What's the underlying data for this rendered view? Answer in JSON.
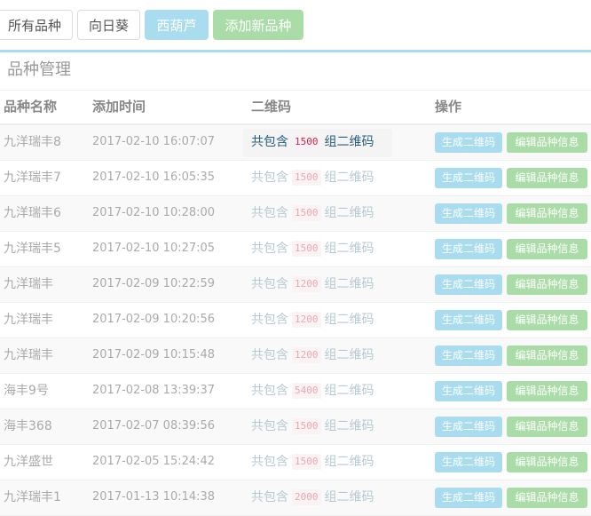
{
  "tabs": [
    {
      "label": "所有品种"
    },
    {
      "label": "向日葵"
    },
    {
      "label": "西葫芦"
    },
    {
      "label": "添加新品种"
    }
  ],
  "panel": {
    "title": "品种管理"
  },
  "table": {
    "headers": [
      "品种名称",
      "添加时间",
      "二维码",
      "操作"
    ],
    "qr_prefix": "共包含",
    "qr_suffix": "组二维码",
    "action_generate": "生成二维码",
    "action_edit": "编辑品种信息",
    "rows": [
      {
        "name": "九洋瑞丰8",
        "time": "2017-02-10 16:07:07",
        "count": "1500"
      },
      {
        "name": "九洋瑞丰7",
        "time": "2017-02-10 16:05:35",
        "count": "1500"
      },
      {
        "name": "九洋瑞丰6",
        "time": "2017-02-10 10:28:00",
        "count": "1500"
      },
      {
        "name": "九洋瑞丰5",
        "time": "2017-02-10 10:27:05",
        "count": "1500"
      },
      {
        "name": "九洋瑞丰",
        "time": "2017-02-09 10:22:59",
        "count": "1200"
      },
      {
        "name": "九洋瑞丰",
        "time": "2017-02-09 10:20:56",
        "count": "1200"
      },
      {
        "name": "九洋瑞丰",
        "time": "2017-02-09 10:15:48",
        "count": "1200"
      },
      {
        "name": "海丰9号",
        "time": "2017-02-08 13:39:37",
        "count": "5400"
      },
      {
        "name": "海丰368",
        "time": "2017-02-07 08:39:56",
        "count": "1500"
      },
      {
        "name": "九洋盛世",
        "time": "2017-02-05 15:24:42",
        "count": "1500"
      },
      {
        "name": "九洋瑞丰1",
        "time": "2017-01-13 10:14:38",
        "count": "2000"
      }
    ]
  },
  "colors": {
    "accent_blue": "#a8dcee",
    "accent_green": "#a9dca7",
    "count_pink": "#c7254e"
  }
}
